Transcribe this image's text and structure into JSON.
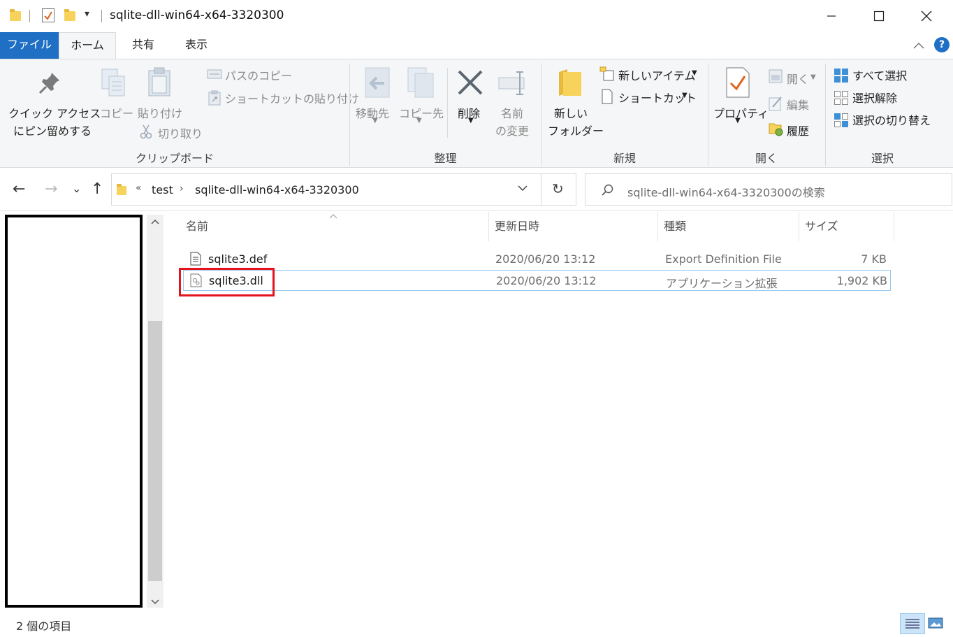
{
  "window": {
    "title": "sqlite-dll-win64-x64-3320300",
    "minimize": "—",
    "maximize": "☐",
    "close": "✕"
  },
  "tabs": {
    "file": "ファイル",
    "home": "ホーム",
    "share": "共有",
    "view": "表示"
  },
  "ribbon": {
    "clipboard": {
      "pin_line1": "クイック アクセス",
      "pin_line2": "にピン留めする",
      "copy": "コピー",
      "paste": "貼り付け",
      "copy_path": "パスのコピー",
      "paste_shortcut": "ショートカットの貼り付け",
      "cut": "切り取り",
      "group": "クリップボード"
    },
    "organize": {
      "move_to": "移動先",
      "copy_to": "コピー先",
      "delete": "削除",
      "rename_line1": "名前",
      "rename_line2": "の変更",
      "group": "整理"
    },
    "new": {
      "new_folder_line1": "新しい",
      "new_folder_line2": "フォルダー",
      "new_item": "新しいアイテム",
      "easy_access": "ショートカット",
      "group": "新規"
    },
    "open": {
      "properties": "プロパティ",
      "open": "開く",
      "edit": "編集",
      "history": "履歴",
      "group": "開く"
    },
    "select": {
      "select_all": "すべて選択",
      "select_none": "選択解除",
      "invert": "選択の切り替え",
      "group": "選択"
    }
  },
  "navigation": {
    "back": "←",
    "forward": "→",
    "recent": "⌄",
    "up": "↑",
    "overflow": "«",
    "breadcrumb": [
      "test",
      "sqlite-dll-win64-x64-3320300"
    ],
    "refresh": "↻",
    "search_placeholder": "sqlite-dll-win64-x64-3320300の検索"
  },
  "file_list": {
    "columns": [
      "名前",
      "更新日時",
      "種類",
      "サイズ"
    ],
    "rows": [
      {
        "name": "sqlite3.def",
        "modified": "2020/06/20 13:12",
        "type": "Export Definition File",
        "size": "7 KB"
      },
      {
        "name": "sqlite3.dll",
        "modified": "2020/06/20 13:12",
        "type": "アプリケーション拡張",
        "size": "1,902 KB",
        "selected": true
      }
    ]
  },
  "status": {
    "count": "2 個の項目"
  },
  "colors": {
    "accent": "#1f6fc5",
    "highlight": "#e3141e",
    "selection_border": "#99c9ef"
  }
}
